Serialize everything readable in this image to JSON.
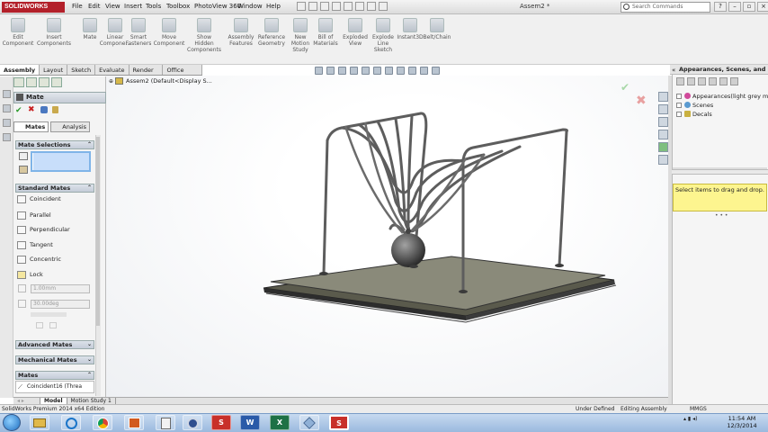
{
  "app": {
    "logo_text": "SOLIDWORKS",
    "document_title": "Assem2 *",
    "menu": [
      "File",
      "Edit",
      "View",
      "Insert",
      "Tools",
      "Toolbox",
      "PhotoView 360",
      "Window",
      "Help"
    ],
    "search_placeholder": "Search Commands",
    "brand_color": "#b3202a"
  },
  "ribbon": {
    "buttons": [
      "Edit\nComponent",
      "Insert\nComponents",
      "Mate",
      "Linear\nCompone...",
      "Smart\nFasteners",
      "Move\nComponent",
      "Show\nHidden\nComponents",
      "Assembly\nFeatures",
      "Reference\nGeometry",
      "New\nMotion\nStudy",
      "Bill of\nMaterials",
      "Exploded\nView",
      "Explode\nLine\nSketch",
      "Instant3D",
      "Belt/Chain"
    ]
  },
  "tabs": [
    "Assembly",
    "Layout",
    "Sketch",
    "Evaluate",
    "Render Tools",
    "Office Products"
  ],
  "property_manager": {
    "title": "Mate",
    "subtabs": [
      "Mates",
      "Analysis"
    ],
    "sections": {
      "mate_selections": "Mate Selections",
      "standard_mates": "Standard Mates",
      "advanced_mates": "Advanced Mates",
      "mechanical_mates": "Mechanical Mates",
      "mates": "Mates"
    },
    "standard_mates": [
      "Coincident",
      "Parallel",
      "Perpendicular",
      "Tangent",
      "Concentric",
      "Lock"
    ],
    "distance_value": "1.00mm",
    "angle_value": "30.00deg",
    "mates_list_item": "Coincident16 (Threa"
  },
  "graphics": {
    "tree_root": "Assem2  (Default<Display S..."
  },
  "bottom_tabs": [
    "Model",
    "Motion Study 1"
  ],
  "status_bar": {
    "left": "SolidWorks Premium 2014 x64 Edition",
    "state": "Under Defined",
    "mode": "Editing Assembly",
    "units": "MMGS"
  },
  "task_pane": {
    "title": "Appearances, Scenes, and D...",
    "items": [
      "Appearances(light grey mediu",
      "Scenes",
      "Decals"
    ],
    "drag_hint": "Select items to drag and drop."
  },
  "taskbar": {
    "time": "11:54 AM",
    "date": "12/3/2014"
  }
}
